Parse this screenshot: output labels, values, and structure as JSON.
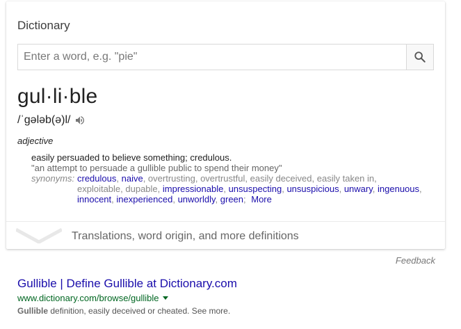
{
  "card": {
    "title": "Dictionary",
    "search": {
      "placeholder": "Enter a word, e.g. \"pie\"",
      "icon": "search-icon"
    },
    "word": "gul·li·ble",
    "phonetic": "/ˈɡələb(ə)l/",
    "part_of_speech": "adjective",
    "definition": "easily persuaded to believe something; credulous.",
    "example": "\"an attempt to persuade a gullible public to spend their money\"",
    "synonyms_label": "synonyms:",
    "synonyms": [
      {
        "text": "credulous",
        "link": true
      },
      {
        "text": "naive",
        "link": true
      },
      {
        "text": "overtrusting",
        "link": false
      },
      {
        "text": "overtrustful",
        "link": false
      },
      {
        "text": "easily deceived",
        "link": false
      },
      {
        "text": "easily taken in",
        "link": false
      },
      {
        "text": "exploitable",
        "link": false
      },
      {
        "text": "dupable",
        "link": false
      },
      {
        "text": "impressionable",
        "link": true
      },
      {
        "text": "unsuspecting",
        "link": true
      },
      {
        "text": "unsuspicious",
        "link": true
      },
      {
        "text": "unwary",
        "link": true
      },
      {
        "text": "ingenuous",
        "link": true
      },
      {
        "text": "innocent",
        "link": true
      },
      {
        "text": "inexperienced",
        "link": true
      },
      {
        "text": "unworldly",
        "link": true
      },
      {
        "text": "green",
        "link": true
      }
    ],
    "more_label": "More",
    "expand_label": "Translations, word origin, and more definitions"
  },
  "feedback_label": "Feedback",
  "result": {
    "title": "Gullible | Define Gullible at Dictionary.com",
    "url": "www.dictionary.com/browse/gullible",
    "snippet_bold": "Gullible",
    "snippet_rest": " definition, easily deceived or cheated. See more."
  },
  "colors": {
    "link": "#1a0dab",
    "url": "#006621",
    "muted": "#878787"
  }
}
